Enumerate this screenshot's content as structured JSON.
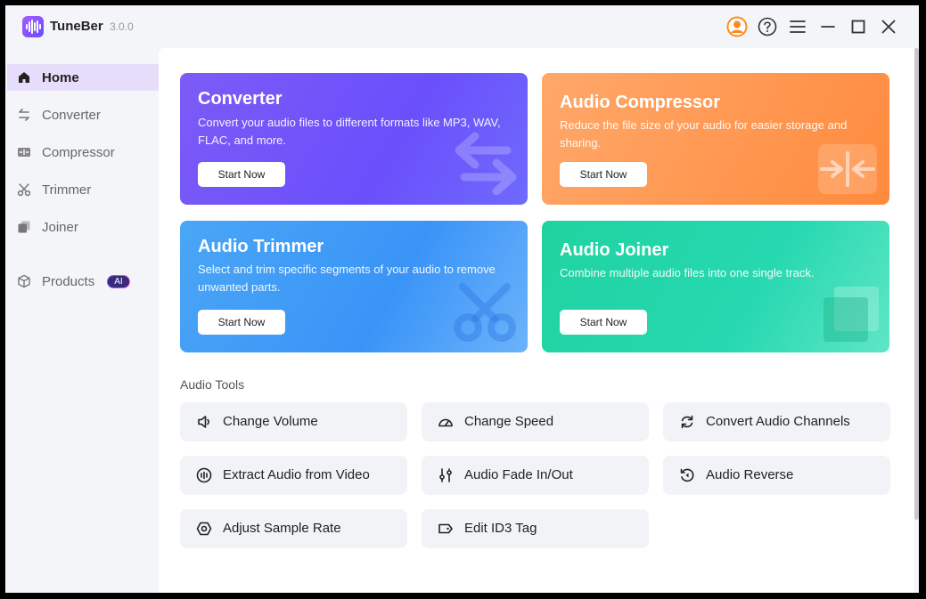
{
  "app": {
    "name": "TuneBer",
    "version": "3.0.0"
  },
  "titlebar": {
    "buttons": [
      {
        "name": "account-icon"
      },
      {
        "name": "help-icon"
      },
      {
        "name": "menu-icon"
      },
      {
        "name": "minimize-icon"
      },
      {
        "name": "maximize-icon"
      },
      {
        "name": "close-icon"
      }
    ]
  },
  "sidebar": {
    "items": [
      {
        "label": "Home",
        "icon": "home-icon",
        "active": true
      },
      {
        "label": "Converter",
        "icon": "convert-icon"
      },
      {
        "label": "Compressor",
        "icon": "compress-icon"
      },
      {
        "label": "Trimmer",
        "icon": "scissors-icon"
      },
      {
        "label": "Joiner",
        "icon": "joiner-icon"
      },
      {
        "label": "Products",
        "icon": "cube-icon",
        "badge": "AI"
      }
    ]
  },
  "cards": [
    {
      "title": "Converter",
      "desc": "Convert your audio files to different formats like MP3, WAV, FLAC, and more.",
      "button": "Start Now",
      "icon": "swap-arrows-icon"
    },
    {
      "title": "Audio Compressor",
      "desc": "Reduce the file size of your audio for easier storage and sharing.",
      "button": "Start Now",
      "icon": "compress-arrows-icon"
    },
    {
      "title": "Audio Trimmer",
      "desc": "Select and trim specific segments of your audio to remove unwanted parts.",
      "button": "Start Now",
      "icon": "scissors-icon"
    },
    {
      "title": "Audio Joiner",
      "desc": "Combine multiple audio files into one single track.",
      "button": "Start Now",
      "icon": "stacked-squares-icon"
    }
  ],
  "tools": {
    "title": "Audio Tools",
    "items": [
      {
        "label": "Change Volume",
        "icon": "volume-icon"
      },
      {
        "label": "Change Speed",
        "icon": "speedometer-icon"
      },
      {
        "label": "Convert Audio Channels",
        "icon": "refresh-icon"
      },
      {
        "label": "Extract Audio from Video",
        "icon": "waveform-circle-icon"
      },
      {
        "label": "Audio Fade In/Out",
        "icon": "sliders-icon"
      },
      {
        "label": "Audio Reverse",
        "icon": "reverse-icon"
      },
      {
        "label": "Adjust Sample Rate",
        "icon": "sample-rate-icon"
      },
      {
        "label": "Edit ID3 Tag",
        "icon": "tag-icon"
      }
    ]
  }
}
